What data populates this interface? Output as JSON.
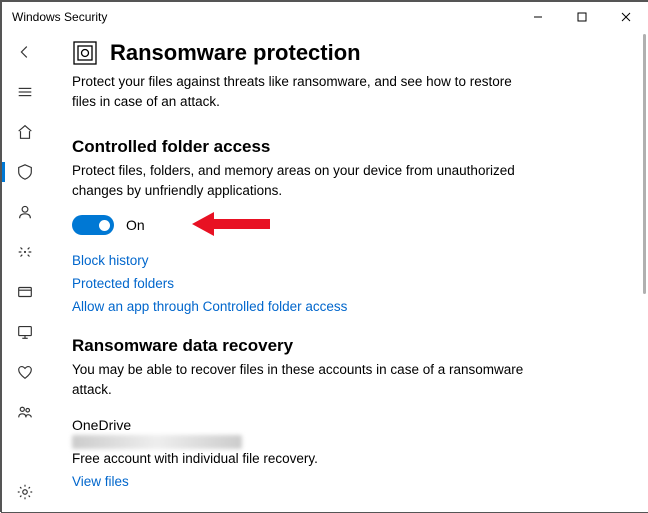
{
  "window": {
    "title": "Windows Security"
  },
  "sidebar": {
    "items": [
      {
        "name": "back"
      },
      {
        "name": "menu"
      },
      {
        "name": "home"
      },
      {
        "name": "virus-threat"
      },
      {
        "name": "account"
      },
      {
        "name": "firewall"
      },
      {
        "name": "app-browser"
      },
      {
        "name": "device-security"
      },
      {
        "name": "device-performance"
      },
      {
        "name": "family"
      }
    ],
    "settings": {
      "name": "settings"
    }
  },
  "page": {
    "title": "Ransomware protection",
    "description": "Protect your files against threats like ransomware, and see how to restore files in case of an attack."
  },
  "controlled_folder": {
    "title": "Controlled folder access",
    "description": "Protect files, folders, and memory areas on your device from unauthorized changes by unfriendly applications.",
    "toggle_state": "On",
    "links": {
      "block_history": "Block history",
      "protected_folders": "Protected folders",
      "allow_app": "Allow an app through Controlled folder access"
    }
  },
  "data_recovery": {
    "title": "Ransomware data recovery",
    "description": "You may be able to recover files in these accounts in case of a ransomware attack.",
    "provider": "OneDrive",
    "provider_desc": "Free account with individual file recovery.",
    "view_files": "View files"
  }
}
